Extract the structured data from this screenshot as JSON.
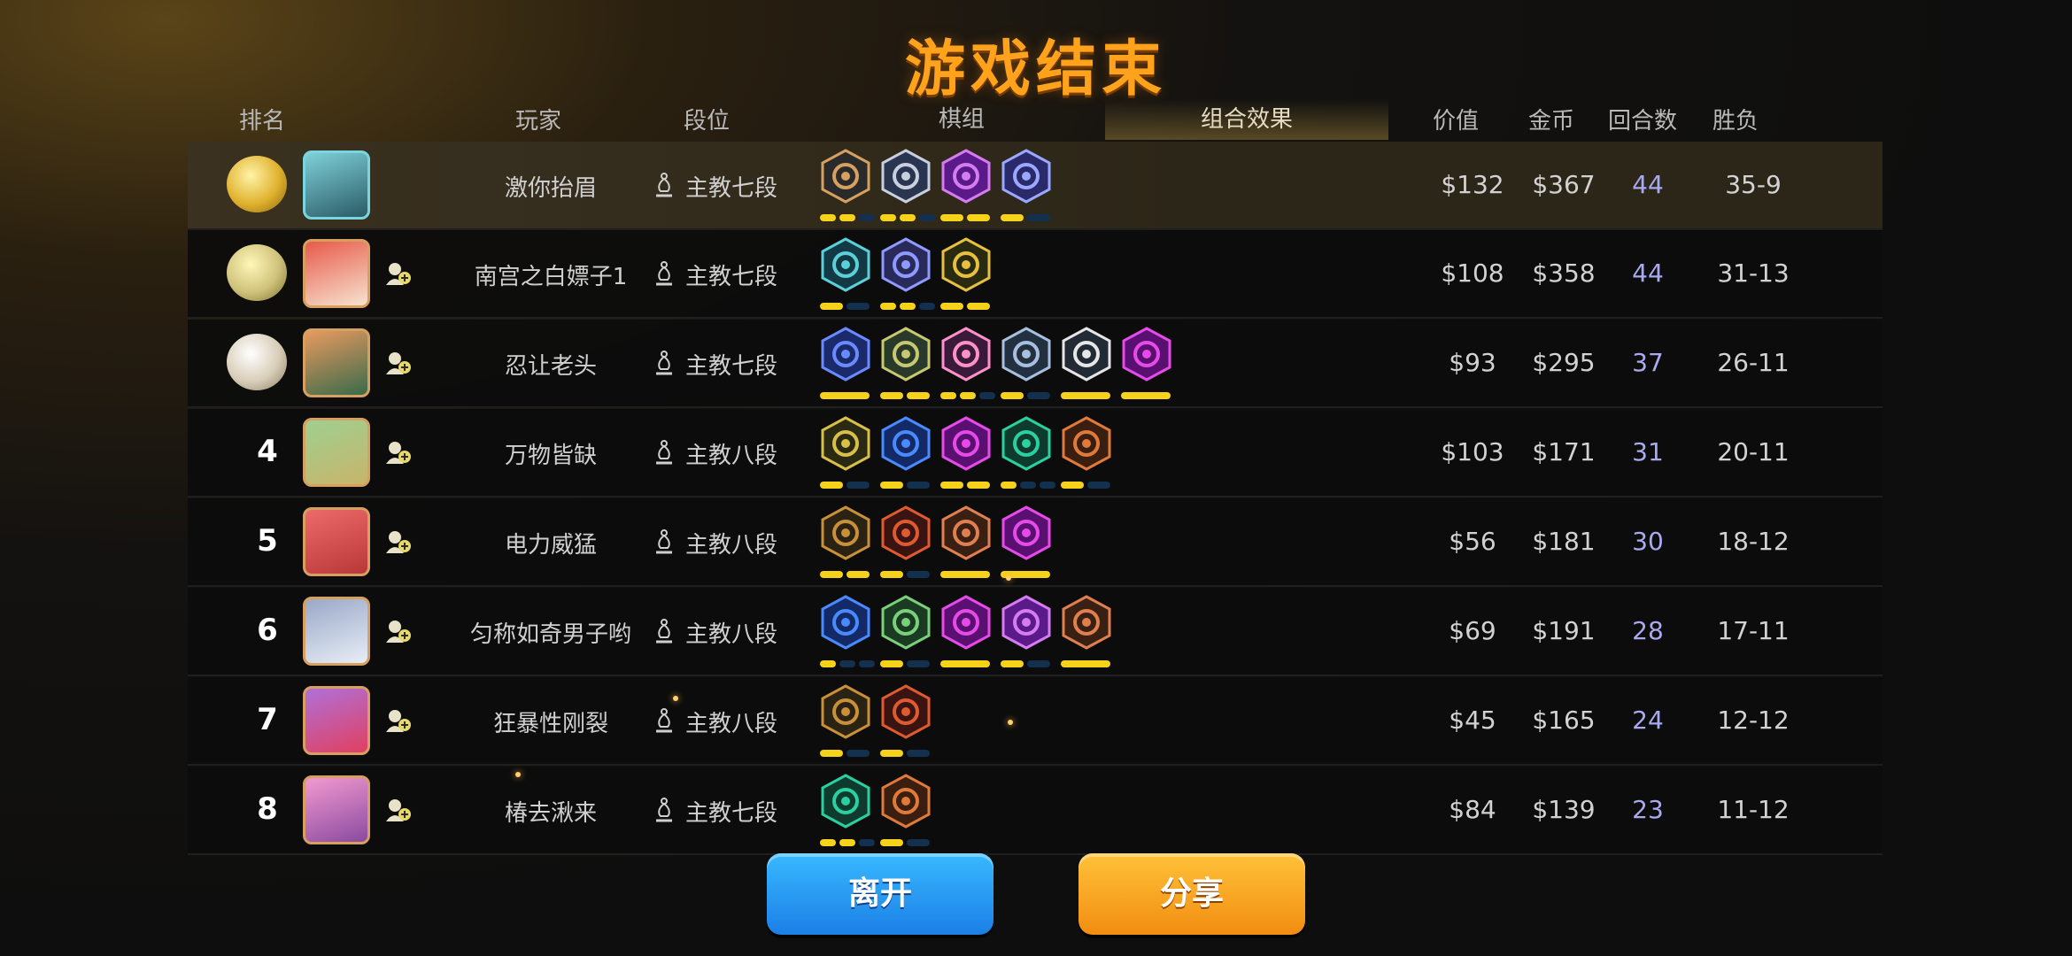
{
  "title": "游戏结束",
  "headers": {
    "rank": "排名",
    "player": "玩家",
    "tier": "段位",
    "group": "棋组",
    "combo": "组合效果",
    "value": "价值",
    "gold": "金币",
    "rounds": "回合数",
    "record": "胜负"
  },
  "colors": {
    "title": "#ffa21c",
    "bar_on": "#f6d21b",
    "bar_off": "#13304f",
    "rounds_text": "#a9a9f0"
  },
  "rows": [
    {
      "rank": "",
      "medal": "gold",
      "name": "激你抬眉",
      "tier": "主教七段",
      "value": "$132",
      "gold": "$367",
      "rounds": "44",
      "record": "35-9",
      "synergies": [
        "axe-icon",
        "helmet-icon",
        "demon-icon",
        "fishbone-icon"
      ]
    },
    {
      "rank": "",
      "medal": "silver",
      "name": "南宫之白嫖子1",
      "tier": "主教七段",
      "value": "$108",
      "gold": "$358",
      "rounds": "44",
      "record": "31-13",
      "synergies": [
        "ghost-icon",
        "book-icon",
        "ring-icon"
      ]
    },
    {
      "rank": "",
      "medal": "bronze",
      "name": "忍让老头",
      "tier": "主教七段",
      "value": "$93",
      "gold": "$295",
      "rounds": "37",
      "record": "26-11",
      "synergies": [
        "ice-icon",
        "turtle-icon",
        "knight-icon",
        "orbs-icon",
        "cross-icon",
        "devil-icon"
      ]
    },
    {
      "rank": "4",
      "medal": "",
      "name": "万物皆缺",
      "tier": "主教八段",
      "value": "$103",
      "gold": "$171",
      "rounds": "31",
      "record": "20-11",
      "synergies": [
        "claw-icon",
        "feather-icon",
        "devil-icon",
        "paw-icon",
        "leaf-icon"
      ]
    },
    {
      "rank": "5",
      "medal": "",
      "name": "电力威猛",
      "tier": "主教八段",
      "value": "$56",
      "gold": "$181",
      "rounds": "30",
      "record": "18-12",
      "synergies": [
        "gear-icon",
        "bull-icon",
        "viking-icon",
        "devil-icon"
      ]
    },
    {
      "rank": "6",
      "medal": "",
      "name": "匀称如奇男子哟",
      "tier": "主教八段",
      "value": "$69",
      "gold": "$191",
      "rounds": "28",
      "record": "17-11",
      "synergies": [
        "feather-icon",
        "bow-icon",
        "devil-icon",
        "demon-icon",
        "viking-icon"
      ]
    },
    {
      "rank": "7",
      "medal": "",
      "name": "狂暴性刚裂",
      "tier": "主教八段",
      "value": "$45",
      "gold": "$165",
      "rounds": "24",
      "record": "12-12",
      "synergies": [
        "gear-icon",
        "bull-icon"
      ]
    },
    {
      "rank": "8",
      "medal": "",
      "name": "椿去湫来",
      "tier": "主教七段",
      "value": "$84",
      "gold": "$139",
      "rounds": "23",
      "record": "11-12",
      "synergies": [
        "paw-icon",
        "leaf-icon"
      ]
    }
  ],
  "buttons": {
    "leave": "离开",
    "share": "分享"
  }
}
